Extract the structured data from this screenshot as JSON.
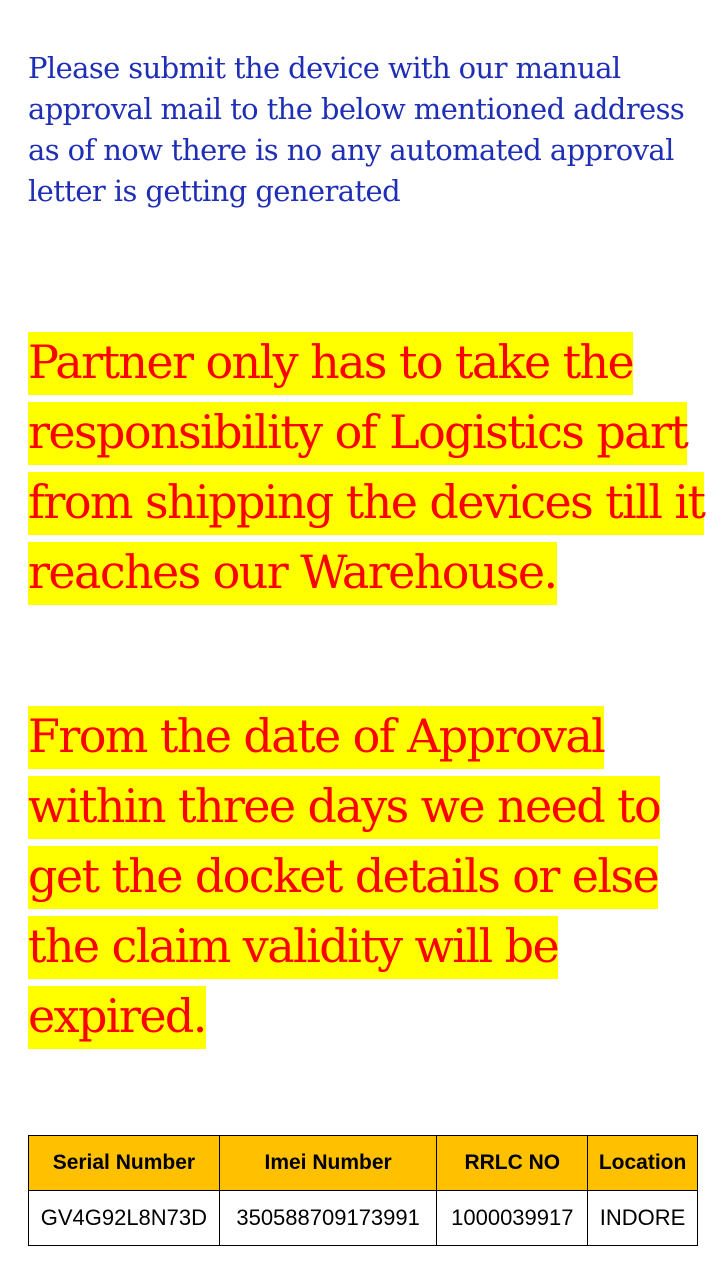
{
  "intro_text": "Please submit the device with our manual approval mail to the below mentioned address as of now there is no any automated approval letter is getting generated",
  "notice_1": "Partner only has to take the responsibility of Logistics part from shipping the devices till it  reaches our Warehouse.",
  "notice_2": "From the date of Approval within three days we need to get the docket details or else the claim validity will be expired.",
  "table": {
    "headers": [
      "Serial Number",
      "Imei Number",
      "RRLC NO",
      "Location"
    ],
    "rows": [
      [
        "GV4G92L8N73D",
        "350588709173991",
        "1000039917",
        "INDORE"
      ]
    ]
  },
  "colors": {
    "intro_text": "#1f2fb5",
    "notice_text": "#ff0000",
    "highlight": "#ffff00",
    "table_header": "#ffc000"
  }
}
